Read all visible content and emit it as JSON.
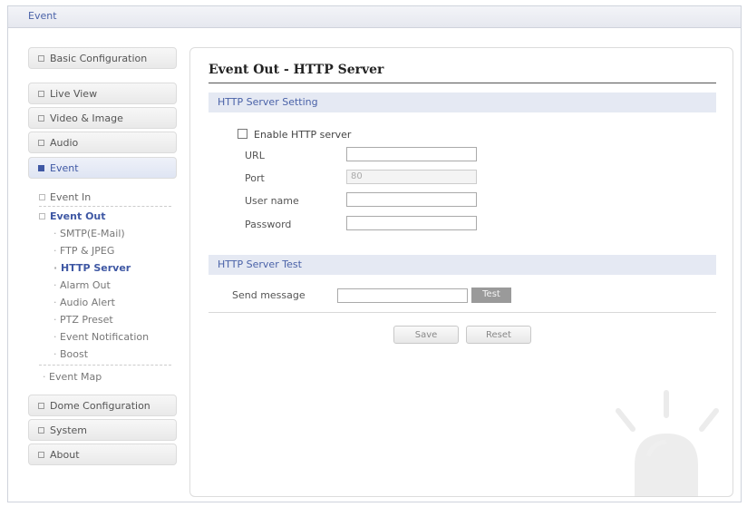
{
  "header": {
    "title": "Event"
  },
  "sidebar": {
    "items": [
      {
        "label": "Basic Configuration"
      },
      {
        "label": "Live View"
      },
      {
        "label": "Video & Image"
      },
      {
        "label": "Audio"
      },
      {
        "label": "Event"
      },
      {
        "label": "Dome Configuration"
      },
      {
        "label": "System"
      },
      {
        "label": "About"
      }
    ],
    "event_sub": {
      "event_in": "Event In",
      "event_out": "Event Out",
      "event_out_items": [
        "SMTP(E-Mail)",
        "FTP & JPEG",
        "HTTP Server",
        "Alarm Out",
        "Audio Alert",
        "PTZ Preset",
        "Event Notification",
        "Boost"
      ],
      "event_map": "Event Map"
    }
  },
  "main": {
    "title": "Event Out - HTTP Server",
    "setting_section": "HTTP Server Setting",
    "enable_label": "Enable HTTP server",
    "enable_checked": false,
    "fields": {
      "url_label": "URL",
      "url_value": "",
      "port_label": "Port",
      "port_value": "80",
      "username_label": "User name",
      "username_value": "",
      "password_label": "Password",
      "password_value": ""
    },
    "test_section": "HTTP Server Test",
    "send_label": "Send message",
    "send_value": "",
    "test_button": "Test",
    "save_button": "Save",
    "reset_button": "Reset"
  },
  "icons": {
    "decor": "siren-alarm-icon"
  },
  "colors": {
    "accent": "#3f58a4",
    "section_bg": "#e5e9f3"
  }
}
